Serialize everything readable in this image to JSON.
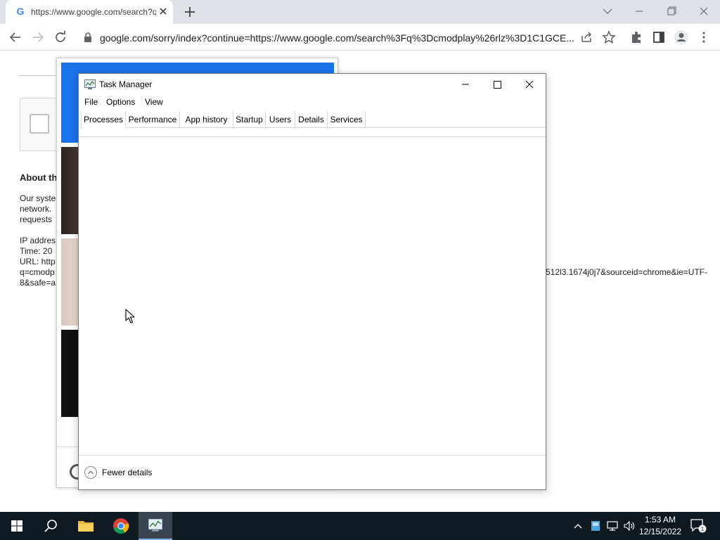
{
  "browser": {
    "tab_title": "https://www.google.com/search?q=cmodplay",
    "favicon_letter": "G",
    "url": "google.com/sorry/index?continue=https://www.google.com/search%3Fq%3Dcmodplay%26rlz%3D1C1GCE..."
  },
  "page": {
    "about_heading": "About th",
    "para1": [
      "Our syste",
      "network.",
      "requests"
    ],
    "para2": [
      "IP addres",
      "Time: 20",
      "URL: http",
      "q=cmodp",
      "8&safe=a"
    ],
    "url_tail": "512l3.1674j0j7&sourceid=chrome&ie=UTF-"
  },
  "taskmgr": {
    "title": "Task Manager",
    "menu": [
      "File",
      "Options",
      "View"
    ],
    "tabs": [
      "Processes",
      "Performance",
      "App history",
      "Startup",
      "Users",
      "Details",
      "Services"
    ],
    "active_tab": "Processes",
    "footer_label": "Fewer details"
  },
  "taskbar": {
    "time": "1:53 AM",
    "date": "12/15/2022",
    "notification_count": "1"
  },
  "colors": {
    "taskbar_bg": "#101820",
    "chrome_tabstrip": "#dee1e6",
    "captcha_blue": "#1a73e8"
  }
}
